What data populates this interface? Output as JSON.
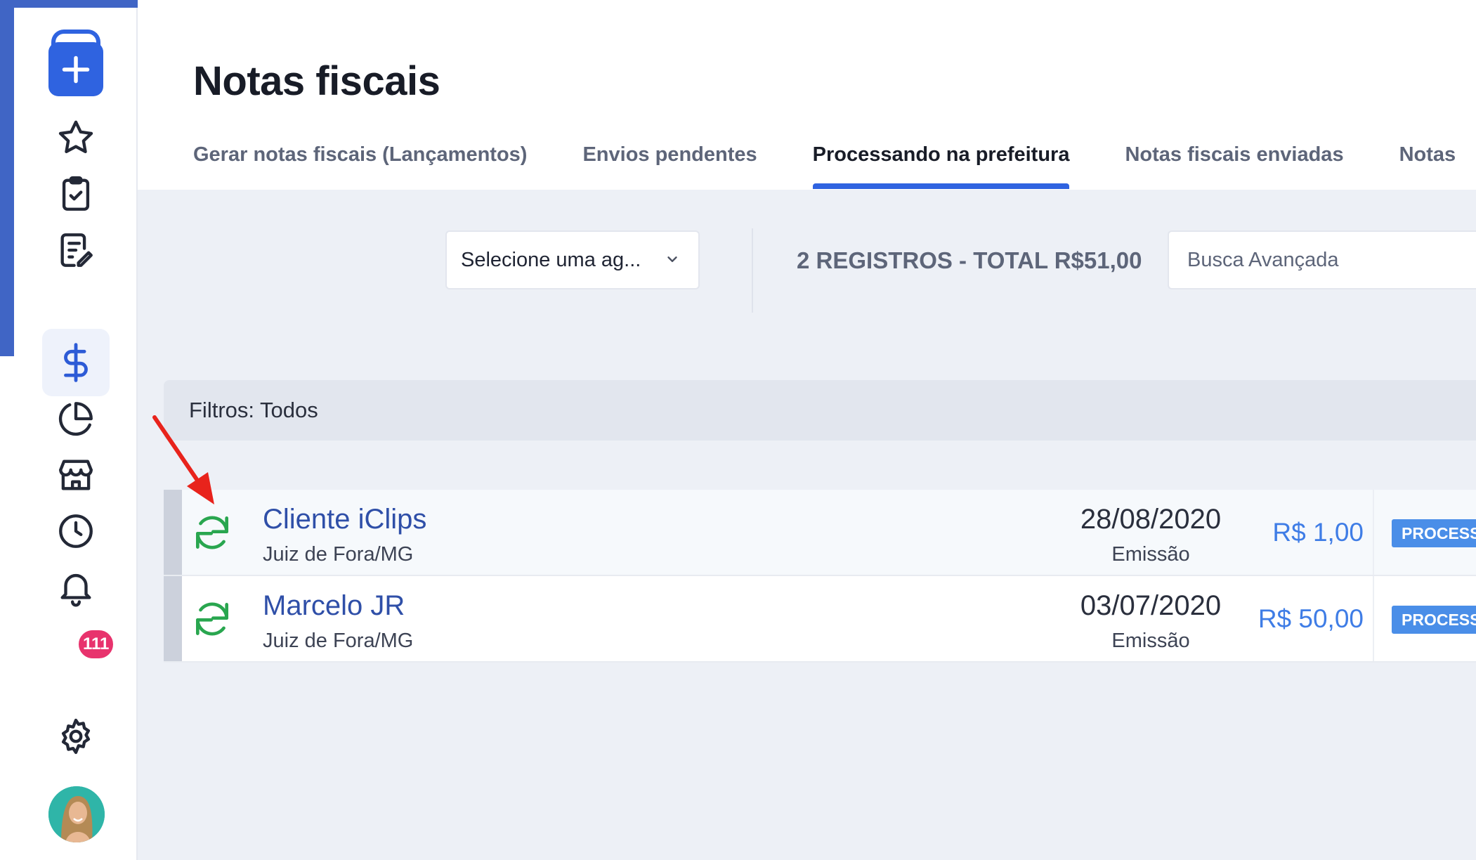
{
  "page": {
    "title": "Notas fiscais"
  },
  "sidebar": {
    "items": [
      {
        "name": "add",
        "icon": "plus-icon"
      },
      {
        "name": "favorites",
        "icon": "star-icon"
      },
      {
        "name": "tasks",
        "icon": "clipboard-check-icon"
      },
      {
        "name": "notes",
        "icon": "document-edit-icon"
      },
      {
        "name": "finance",
        "icon": "dollar-icon",
        "active": true
      },
      {
        "name": "reports",
        "icon": "pie-chart-icon"
      },
      {
        "name": "store",
        "icon": "store-icon"
      },
      {
        "name": "history",
        "icon": "clock-icon"
      },
      {
        "name": "notifications",
        "icon": "bell-icon",
        "badge": "111"
      },
      {
        "name": "settings",
        "icon": "gear-icon"
      },
      {
        "name": "profile",
        "icon": "avatar"
      }
    ],
    "notification_badge": "111",
    "accent_color": "#2f63e0"
  },
  "tabs": [
    {
      "label": "Gerar notas fiscais (Lançamentos)",
      "active": false
    },
    {
      "label": "Envios pendentes",
      "active": false
    },
    {
      "label": "Processando na prefeitura",
      "active": true
    },
    {
      "label": "Notas fiscais enviadas",
      "active": false
    },
    {
      "label": "Notas",
      "active": false
    }
  ],
  "toolbar": {
    "select_value": "Selecione uma ag...",
    "summary": "2 REGISTROS - TOTAL R$51,00",
    "search_placeholder": "Busca Avançada"
  },
  "filters": {
    "text": "Filtros: Todos"
  },
  "rows": [
    {
      "name": "Cliente iClips",
      "city": "Juiz de Fora/MG",
      "date": "28/08/2020",
      "date_label": "Emissão",
      "amount": "R$ 1,00",
      "status": "PROCESS"
    },
    {
      "name": "Marcelo JR",
      "city": "Juiz de Fora/MG",
      "date": "03/07/2020",
      "date_label": "Emissão",
      "amount": "R$ 50,00",
      "status": "PROCESS"
    }
  ],
  "colors": {
    "frame": "#4065c5",
    "status_icon": "#29a64f",
    "amount": "#3f7de6",
    "status_badge": "#4a8ee8",
    "badge": "#e8336d",
    "annotation_arrow": "#e8231c"
  }
}
